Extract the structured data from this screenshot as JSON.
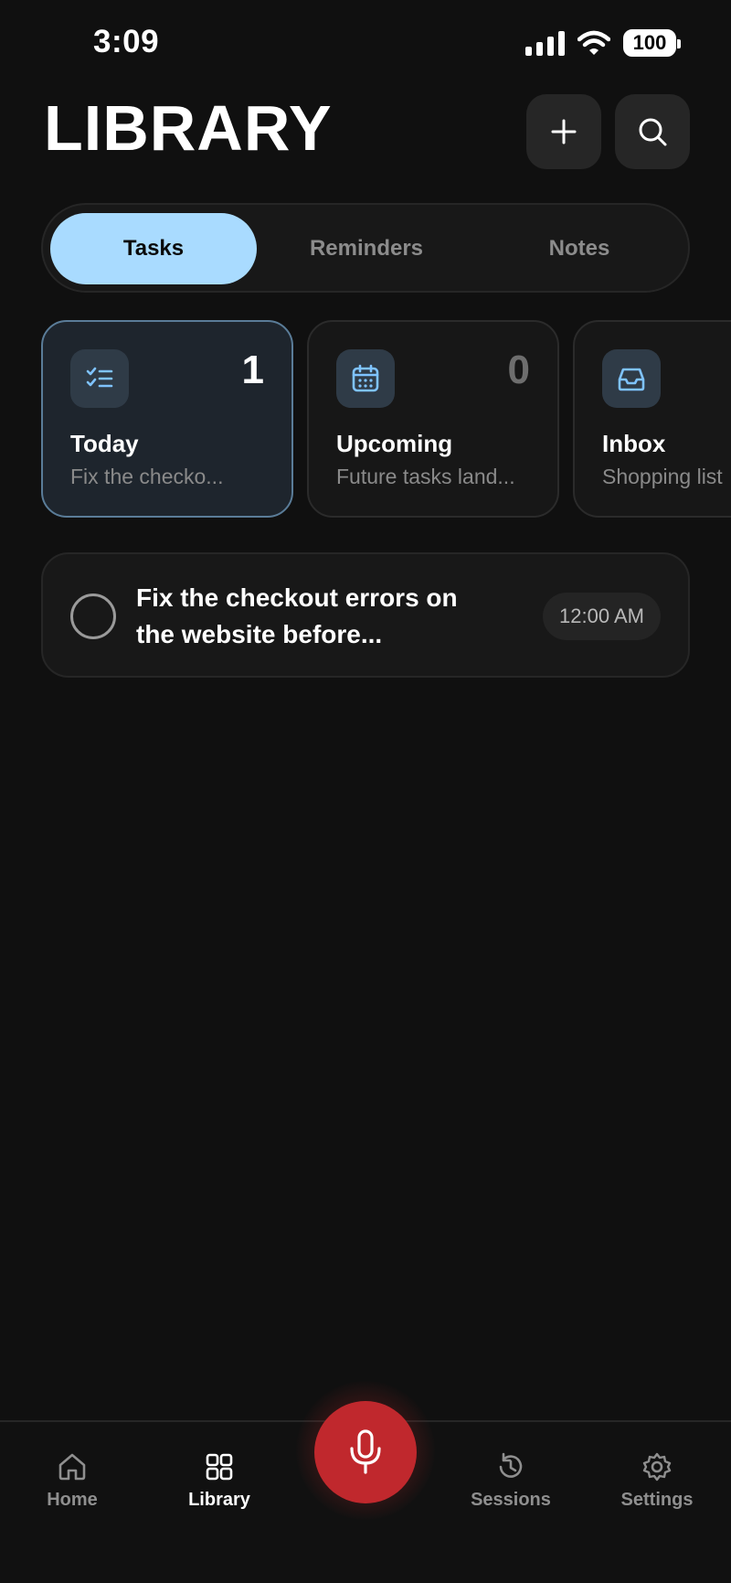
{
  "status_bar": {
    "time": "3:09",
    "battery": "100"
  },
  "header": {
    "title": "LIBRARY",
    "add_icon": "plus-icon",
    "search_icon": "search-icon"
  },
  "tabs": [
    {
      "label": "Tasks",
      "active": true
    },
    {
      "label": "Reminders",
      "active": false
    },
    {
      "label": "Notes",
      "active": false
    }
  ],
  "cards": [
    {
      "title": "Today",
      "subtitle": "Fix the checko...",
      "count": "1",
      "icon": "checklist-icon",
      "selected": true
    },
    {
      "title": "Upcoming",
      "subtitle": "Future tasks land...",
      "count": "0",
      "icon": "calendar-icon",
      "selected": false
    },
    {
      "title": "Inbox",
      "subtitle": "Shopping list",
      "count": "",
      "icon": "inbox-tray-icon",
      "selected": false
    }
  ],
  "tasks": [
    {
      "text": "Fix the checkout errors on the website before...",
      "time": "12:00 AM",
      "completed": false
    }
  ],
  "bottom_nav": {
    "items": [
      {
        "label": "Home",
        "icon": "home-icon",
        "active": false
      },
      {
        "label": "Library",
        "icon": "grid-icon",
        "active": true
      },
      {
        "label": "Sessions",
        "icon": "history-icon",
        "active": false
      },
      {
        "label": "Settings",
        "icon": "gear-icon",
        "active": false
      }
    ],
    "center_action_icon": "microphone-icon"
  },
  "colors": {
    "background": "#101010",
    "accent": "#a9dbff",
    "mic_button": "#c0282d",
    "card_icon": "#7fc3ff"
  }
}
